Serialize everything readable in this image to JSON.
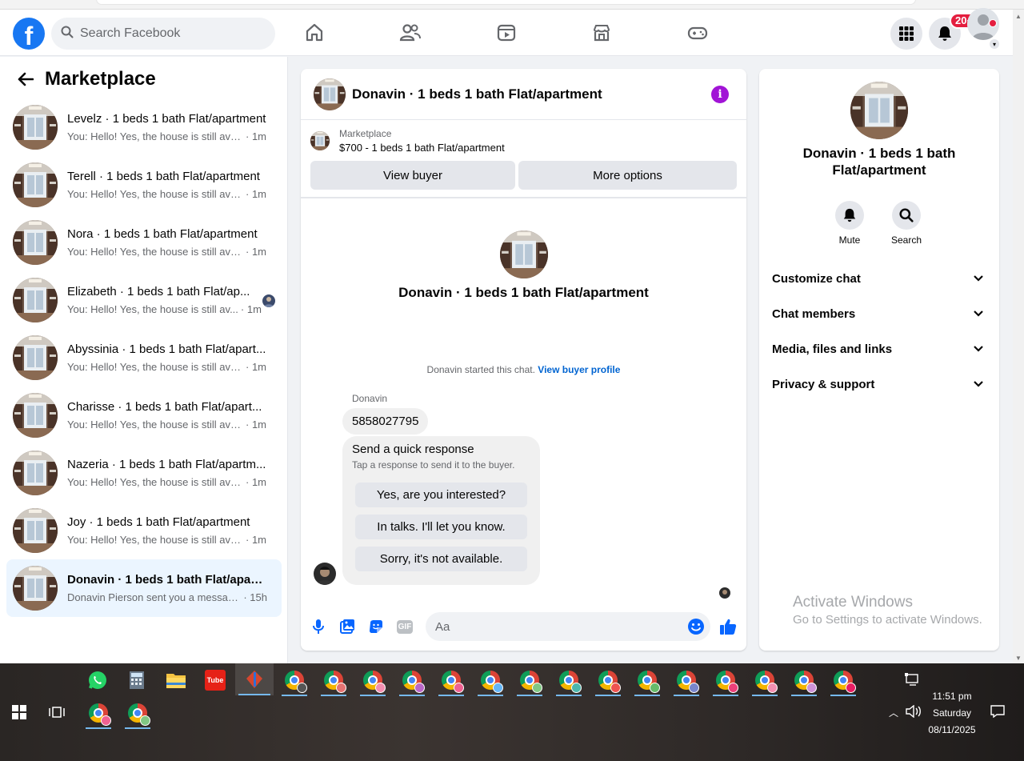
{
  "topbar": {
    "search_placeholder": "Search Facebook",
    "notification_count": "20+"
  },
  "sidebar": {
    "title": "Marketplace",
    "conversations": [
      {
        "name": "Levelz · 1 beds 1 bath Flat/apartment",
        "preview": "You: Hello! Yes, the house is still avail...",
        "time": "· 1m"
      },
      {
        "name": "Terell · 1 beds 1 bath Flat/apartment",
        "preview": "You: Hello! Yes, the house is still avail...",
        "time": "· 1m"
      },
      {
        "name": "Nora · 1 beds 1 bath Flat/apartment",
        "preview": "You: Hello! Yes, the house is still avail...",
        "time": "· 1m"
      },
      {
        "name": "Elizabeth · 1 beds 1 bath Flat/ap...",
        "preview": "You: Hello! Yes, the house is still av...",
        "time": "· 1m"
      },
      {
        "name": "Abyssinia · 1 beds 1 bath Flat/apart...",
        "preview": "You: Hello! Yes, the house is still avail...",
        "time": "· 1m"
      },
      {
        "name": "Charisse · 1 beds 1 bath Flat/apart...",
        "preview": "You: Hello! Yes, the house is still avail...",
        "time": "· 1m"
      },
      {
        "name": "Nazeria · 1 beds 1 bath Flat/apartm...",
        "preview": "You: Hello! Yes, the house is still avail...",
        "time": "· 1m"
      },
      {
        "name": "Joy · 1 beds 1 bath Flat/apartment",
        "preview": "You: Hello! Yes, the house is still avail...",
        "time": "· 1m"
      },
      {
        "name": "Donavin · 1 beds 1 bath Flat/apart...",
        "preview": "Donavin Pierson sent you a message...",
        "time": "· 15h"
      }
    ]
  },
  "chat": {
    "title": "Donavin · 1 beds 1 bath Flat/apartment",
    "listing_source": "Marketplace",
    "listing_price": "$700 - 1 beds 1 bath Flat/apartment",
    "view_buyer_label": "View buyer",
    "more_options_label": "More options",
    "started_text": "Donavin started this chat.",
    "view_profile_link": "View buyer profile",
    "sender_name": "Donavin",
    "phone_message": "5858027795",
    "quick_title": "Send a quick response",
    "quick_subtitle": "Tap a response to send it to the buyer.",
    "quick_responses": [
      "Yes, are you interested?",
      "In talks. I'll let you know.",
      "Sorry, it's not available."
    ],
    "input_placeholder": "Aa",
    "gif_label": "GIF"
  },
  "info": {
    "title": "Donavin · 1 beds 1 bath Flat/apartment",
    "mute_label": "Mute",
    "search_label": "Search",
    "sections": [
      "Customize chat",
      "Chat members",
      "Media, files and links",
      "Privacy & support"
    ]
  },
  "watermark": {
    "line1": "Activate Windows",
    "line2": "Go to Settings to activate Windows."
  },
  "taskbar": {
    "time": "11:51 pm",
    "day": "Saturday",
    "date": "08/11/2025",
    "youtube_label": "Tube"
  },
  "colors": {
    "facebook_blue": "#1877f2",
    "active_conversation_bg": "#ebf5ff",
    "messenger_purple": "#a114d6",
    "link_blue": "#0064d1",
    "notification_red": "#e41e3f"
  }
}
